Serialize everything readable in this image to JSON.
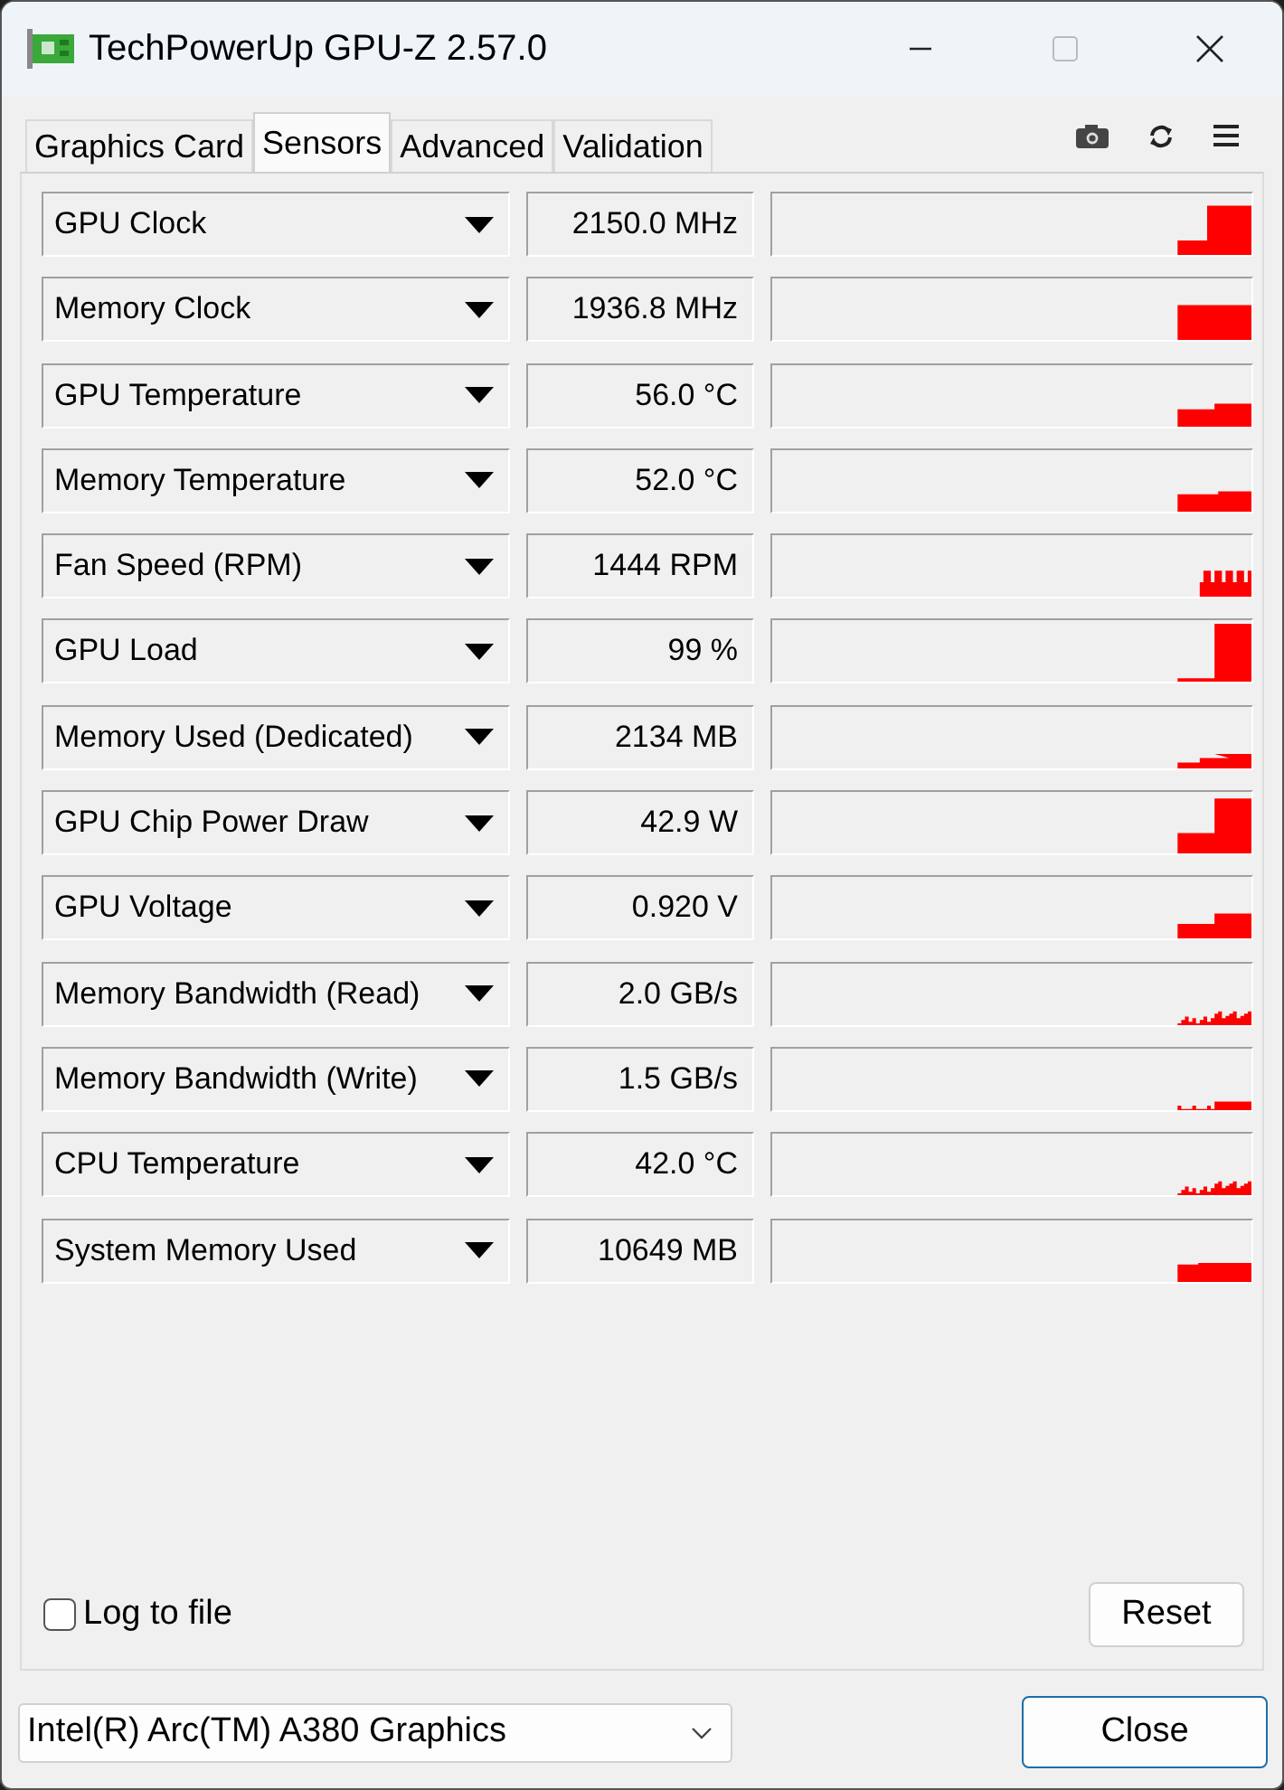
{
  "window": {
    "title": "TechPowerUp GPU-Z 2.57.0"
  },
  "tabs": [
    {
      "label": "Graphics Card",
      "selected": false
    },
    {
      "label": "Sensors",
      "selected": true
    },
    {
      "label": "Advanced",
      "selected": false
    },
    {
      "label": "Validation",
      "selected": false
    }
  ],
  "sensors": [
    {
      "name": "GPU Clock",
      "value": "2150.0 MHz"
    },
    {
      "name": "Memory Clock",
      "value": "1936.8 MHz"
    },
    {
      "name": "GPU Temperature",
      "value": "56.0 °C"
    },
    {
      "name": "Memory Temperature",
      "value": "52.0 °C"
    },
    {
      "name": "Fan Speed (RPM)",
      "value": "1444 RPM"
    },
    {
      "name": "GPU Load",
      "value": "99 %"
    },
    {
      "name": "Memory Used (Dedicated)",
      "value": "2134 MB"
    },
    {
      "name": "GPU Chip Power Draw",
      "value": "42.9 W"
    },
    {
      "name": "GPU Voltage",
      "value": "0.920 V"
    },
    {
      "name": "Memory Bandwidth (Read)",
      "value": "2.0 GB/s"
    },
    {
      "name": "Memory Bandwidth (Write)",
      "value": "1.5 GB/s"
    },
    {
      "name": "CPU Temperature",
      "value": "42.0 °C"
    },
    {
      "name": "System Memory Used",
      "value": "10649 MB"
    }
  ],
  "log_to_file": {
    "label": "Log to file",
    "checked": false
  },
  "reset_button": "Reset",
  "device": {
    "value": "Intel(R) Arc(TM) A380 Graphics"
  },
  "close_button": "Close"
}
